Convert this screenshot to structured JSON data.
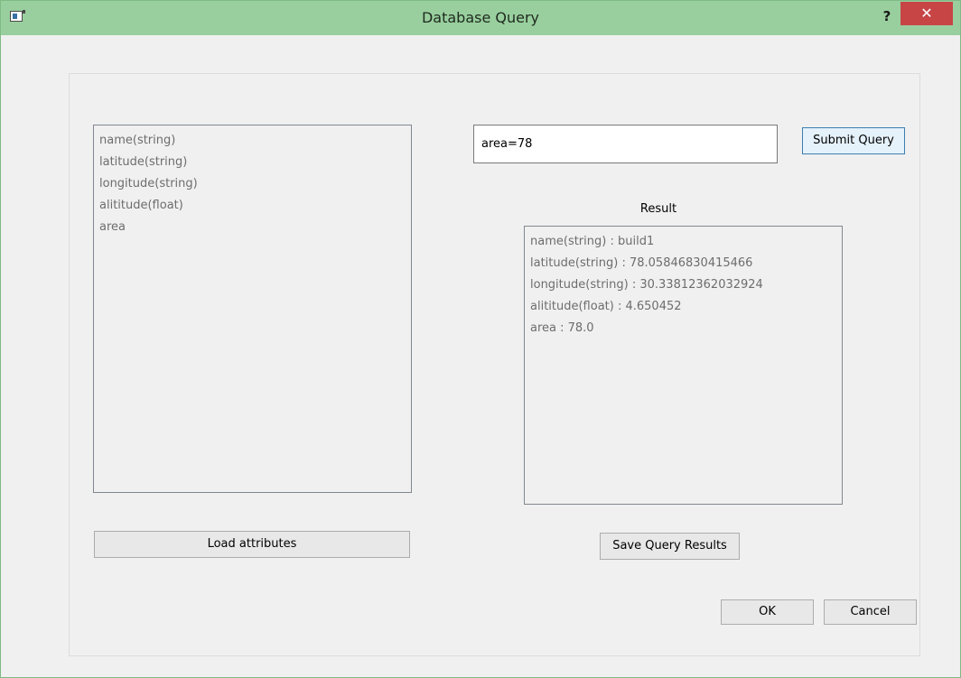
{
  "window": {
    "title": "Database Query",
    "help_glyph": "?",
    "close_glyph": "✕"
  },
  "attributes": {
    "items": [
      "name(string)",
      "latitude(string)",
      "longitude(string)",
      "alititude(float)",
      "area"
    ],
    "load_label": "Load attributes"
  },
  "query": {
    "value": "area=78",
    "submit_label": "Submit Query"
  },
  "result": {
    "label": "Result",
    "items": [
      "name(string) : build1",
      "latitude(string) : 78.05846830415466",
      "longitude(string) : 30.33812362032924",
      "alititude(float) : 4.650452",
      "area : 78.0"
    ],
    "save_label": "Save Query Results"
  },
  "dialog": {
    "ok_label": "OK",
    "cancel_label": "Cancel"
  },
  "colors": {
    "titlebar": "#99cf9e",
    "close_button": "#c74545",
    "window_bg": "#f0f0f0"
  }
}
